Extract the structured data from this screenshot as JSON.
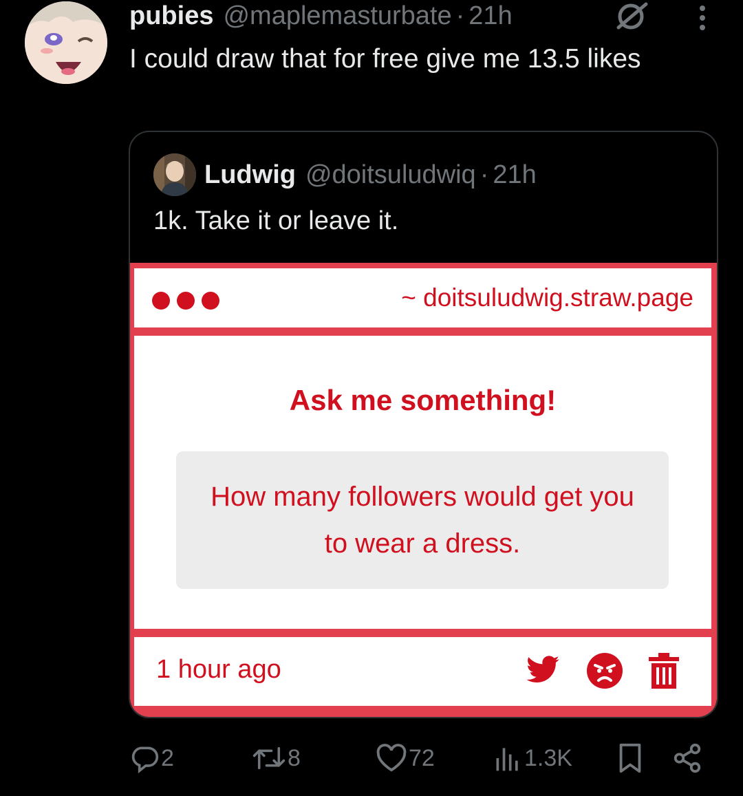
{
  "tweet": {
    "display_name": "pubies",
    "handle": "@maplemasturbate",
    "separator": "·",
    "time": "21h",
    "text": "I could draw that for free give me 13.5 likes"
  },
  "quoted_tweet": {
    "display_name": "Ludwig",
    "handle": "@doitsuludwiq",
    "separator": "·",
    "time": "21h",
    "text": "1k. Take it or leave it.",
    "media": {
      "url": "~ doitsuludwig.straw.page",
      "heading": "Ask me something!",
      "question": "How many followers would get you to wear a dress.",
      "time_ago": "1 hour ago",
      "accent_color": "#d0101e",
      "icons": [
        "twitter-icon",
        "angry-face-icon",
        "trash-icon"
      ]
    }
  },
  "actions": {
    "replies": "2",
    "retweets": "8",
    "likes": "72",
    "views": "1.3K"
  },
  "colors": {
    "background": "#000000",
    "text_primary": "#e7e9ea",
    "text_secondary": "#71767b",
    "border": "#2f3336"
  }
}
